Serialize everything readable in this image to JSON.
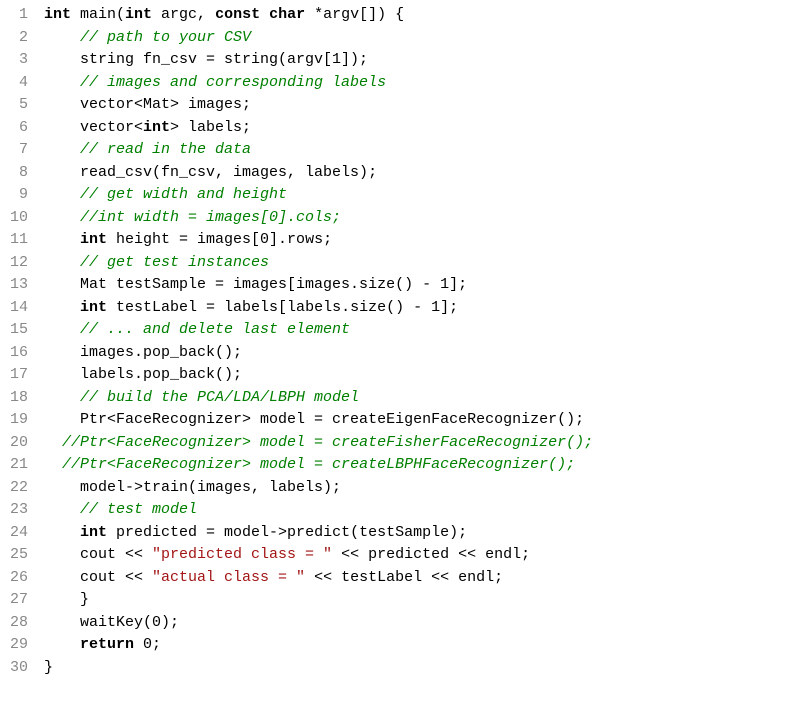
{
  "code": {
    "lines": [
      {
        "num": "1",
        "indent": 0,
        "segments": [
          {
            "cls": "keyword",
            "text": "int"
          },
          {
            "cls": "",
            "text": " main("
          },
          {
            "cls": "keyword",
            "text": "int"
          },
          {
            "cls": "",
            "text": " argc, "
          },
          {
            "cls": "keyword",
            "text": "const"
          },
          {
            "cls": "",
            "text": " "
          },
          {
            "cls": "keyword",
            "text": "char"
          },
          {
            "cls": "",
            "text": " *argv[]) {"
          }
        ]
      },
      {
        "num": "2",
        "indent": 1,
        "segments": [
          {
            "cls": "comment",
            "text": "// path to your CSV"
          }
        ]
      },
      {
        "num": "3",
        "indent": 1,
        "segments": [
          {
            "cls": "",
            "text": "string fn_csv = string(argv[1]);"
          }
        ]
      },
      {
        "num": "4",
        "indent": 1,
        "segments": [
          {
            "cls": "comment",
            "text": "// images and corresponding labels"
          }
        ]
      },
      {
        "num": "5",
        "indent": 1,
        "segments": [
          {
            "cls": "",
            "text": "vector<Mat> images;"
          }
        ]
      },
      {
        "num": "6",
        "indent": 1,
        "segments": [
          {
            "cls": "",
            "text": "vector<"
          },
          {
            "cls": "keyword",
            "text": "int"
          },
          {
            "cls": "",
            "text": "> labels;"
          }
        ]
      },
      {
        "num": "7",
        "indent": 1,
        "segments": [
          {
            "cls": "comment",
            "text": "// read in the data"
          }
        ]
      },
      {
        "num": "8",
        "indent": 1,
        "segments": [
          {
            "cls": "",
            "text": "read_csv(fn_csv, images, labels);"
          }
        ]
      },
      {
        "num": "9",
        "indent": 1,
        "segments": [
          {
            "cls": "comment",
            "text": "// get width and height"
          }
        ]
      },
      {
        "num": "10",
        "indent": 1,
        "segments": [
          {
            "cls": "comment",
            "text": "//int width = images[0].cols;"
          }
        ]
      },
      {
        "num": "11",
        "indent": 1,
        "segments": [
          {
            "cls": "keyword",
            "text": "int"
          },
          {
            "cls": "",
            "text": " height = images[0].rows;"
          }
        ]
      },
      {
        "num": "12",
        "indent": 1,
        "segments": [
          {
            "cls": "comment",
            "text": "// get test instances"
          }
        ]
      },
      {
        "num": "13",
        "indent": 1,
        "segments": [
          {
            "cls": "",
            "text": "Mat testSample = images[images.size() - 1];"
          }
        ]
      },
      {
        "num": "14",
        "indent": 1,
        "segments": [
          {
            "cls": "keyword",
            "text": "int"
          },
          {
            "cls": "",
            "text": " testLabel = labels[labels.size() - 1];"
          }
        ]
      },
      {
        "num": "15",
        "indent": 1,
        "segments": [
          {
            "cls": "comment",
            "text": "// ... and delete last element"
          }
        ]
      },
      {
        "num": "16",
        "indent": 1,
        "segments": [
          {
            "cls": "",
            "text": "images.pop_back();"
          }
        ]
      },
      {
        "num": "17",
        "indent": 1,
        "segments": [
          {
            "cls": "",
            "text": "labels.pop_back();"
          }
        ]
      },
      {
        "num": "18",
        "indent": 1,
        "segments": [
          {
            "cls": "comment",
            "text": "// build the PCA/LDA/LBPH model"
          }
        ]
      },
      {
        "num": "19",
        "indent": 1,
        "segments": [
          {
            "cls": "",
            "text": "Ptr<FaceRecognizer> model = createEigenFaceRecognizer();"
          }
        ]
      },
      {
        "num": "20",
        "indent": 0.5,
        "segments": [
          {
            "cls": "comment",
            "text": "//Ptr<FaceRecognizer> model = createFisherFaceRecognizer();"
          }
        ]
      },
      {
        "num": "21",
        "indent": 0.5,
        "segments": [
          {
            "cls": "comment",
            "text": "//Ptr<FaceRecognizer> model = createLBPHFaceRecognizer();"
          }
        ]
      },
      {
        "num": "22",
        "indent": 1,
        "segments": [
          {
            "cls": "",
            "text": "model->train(images, labels);"
          }
        ]
      },
      {
        "num": "23",
        "indent": 1,
        "segments": [
          {
            "cls": "comment",
            "text": "// test model"
          }
        ]
      },
      {
        "num": "24",
        "indent": 1,
        "segments": [
          {
            "cls": "keyword",
            "text": "int"
          },
          {
            "cls": "",
            "text": " predicted = model->predict(testSample);"
          }
        ]
      },
      {
        "num": "25",
        "indent": 1,
        "segments": [
          {
            "cls": "",
            "text": "cout << "
          },
          {
            "cls": "string",
            "text": "\"predicted class = \""
          },
          {
            "cls": "",
            "text": " << predicted << endl;"
          }
        ]
      },
      {
        "num": "26",
        "indent": 1,
        "segments": [
          {
            "cls": "",
            "text": "cout << "
          },
          {
            "cls": "string",
            "text": "\"actual class = \""
          },
          {
            "cls": "",
            "text": " << testLabel << endl;"
          }
        ]
      },
      {
        "num": "27",
        "indent": 1,
        "segments": [
          {
            "cls": "",
            "text": "}"
          }
        ]
      },
      {
        "num": "28",
        "indent": 1,
        "segments": [
          {
            "cls": "",
            "text": "waitKey(0);"
          }
        ]
      },
      {
        "num": "29",
        "indent": 1,
        "segments": [
          {
            "cls": "keyword",
            "text": "return"
          },
          {
            "cls": "",
            "text": " 0;"
          }
        ]
      },
      {
        "num": "30",
        "indent": 0,
        "segments": [
          {
            "cls": "",
            "text": "}"
          }
        ]
      }
    ]
  }
}
